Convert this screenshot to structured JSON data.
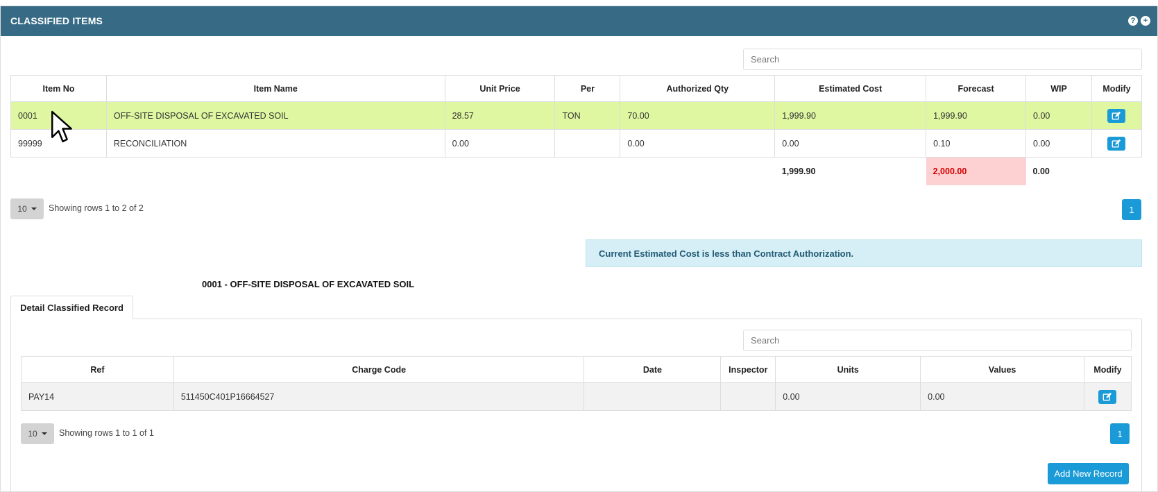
{
  "panel": {
    "title": "CLASSIFIED ITEMS",
    "icons": {
      "help": "?",
      "add": "+"
    }
  },
  "main": {
    "search_placeholder": "Search",
    "columns": [
      "Item No",
      "Item Name",
      "Unit Price",
      "Per",
      "Authorized Qty",
      "Estimated Cost",
      "Forecast",
      "WIP",
      "Modify"
    ],
    "rows": [
      {
        "item_no": "0001",
        "item_name": "OFF-SITE DISPOSAL OF EXCAVATED SOIL",
        "unit_price": "28.57",
        "per": "TON",
        "authorized_qty": "70.00",
        "estimated_cost": "1,999.90",
        "forecast": "1,999.90",
        "wip": "0.00"
      },
      {
        "item_no": "99999",
        "item_name": "RECONCILIATION",
        "unit_price": "0.00",
        "per": "",
        "authorized_qty": "0.00",
        "estimated_cost": "0.00",
        "forecast": "0.10",
        "wip": "0.00"
      }
    ],
    "totals": {
      "estimated_cost": "1,999.90",
      "forecast": "2,000.00",
      "wip": "0.00"
    },
    "page_size": "10",
    "showing": "Showing rows 1 to 2 of 2",
    "page": "1"
  },
  "alert": "Current Estimated Cost is less than Contract Authorization.",
  "detail": {
    "title": "0001 - OFF-SITE DISPOSAL OF EXCAVATED SOIL",
    "tab_label": "Detail Classified Record",
    "search_placeholder": "Search",
    "columns": [
      "Ref",
      "Charge Code",
      "Date",
      "Inspector",
      "Units",
      "Values",
      "Modify"
    ],
    "rows": [
      {
        "ref": "PAY14",
        "charge_code": "511450C401P16664527",
        "date": "",
        "inspector": "",
        "units": "0.00",
        "values": "0.00"
      }
    ],
    "page_size": "10",
    "showing": "Showing rows 1 to 1 of 1",
    "page": "1",
    "add_button": "Add New Record"
  },
  "colors": {
    "header_bg": "#376b85",
    "selected_row": "#dff7a0",
    "primary_button": "#1a9bd7",
    "forecast_alert_bg": "#fdd1d1",
    "forecast_alert_text": "#d40000",
    "info_alert_bg": "#d6eef6"
  }
}
